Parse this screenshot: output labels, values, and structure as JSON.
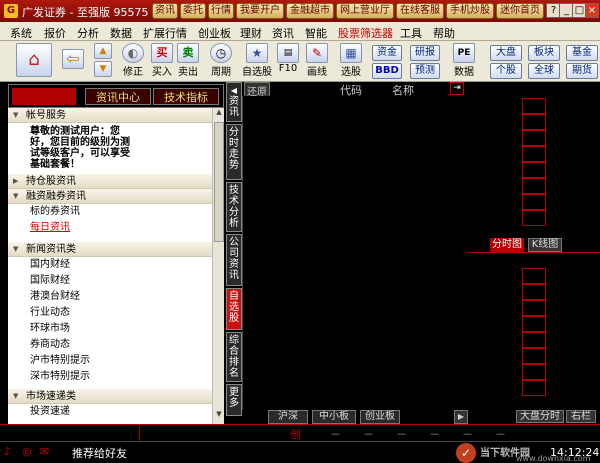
{
  "window": {
    "title": "广发证券 - 至强版",
    "title_overlay": "至强版",
    "phone": "95575",
    "top_buttons": [
      "资讯",
      "委托",
      "行情",
      "我要开户",
      "金融超市",
      "网上营业厅",
      "在线客服",
      "手机炒股",
      "迷你首页"
    ],
    "window_controls": [
      "?",
      "_",
      "□",
      "×"
    ]
  },
  "menu": [
    "系统",
    "报价",
    "分析",
    "数据",
    "扩展行情",
    "创业板",
    "理财",
    "资讯",
    "智能",
    "股票筛选器",
    "工具",
    "帮助"
  ],
  "toolbar": {
    "labels": [
      "修正",
      "买入",
      "卖出",
      "周期",
      "自选股",
      "F10",
      "画线",
      "选股",
      "数据"
    ],
    "buy_glyph": "买",
    "sell_glyph": "卖",
    "small_buttons": [
      "资金",
      "BBD",
      "研报",
      "预测",
      "大盘",
      "个股",
      "板块",
      "全球",
      "基金",
      "期货"
    ],
    "pe_label": "PE"
  },
  "left_panel": {
    "tabs": [
      "资讯中心",
      "技术指标"
    ],
    "sections": [
      {
        "title": "帐号服务",
        "collapsed": false
      },
      {
        "title": "持仓股资讯",
        "collapsed": true
      },
      {
        "title": "融资融券资讯",
        "collapsed": false
      },
      {
        "title": "新闻资讯类",
        "collapsed": false
      },
      {
        "title": "市场速递类",
        "collapsed": false
      }
    ],
    "message_line1": "尊敬的测试用户：您",
    "message_line2": "好，您目前的级别为测",
    "message_line3": "试等级客户，可以享受",
    "message_line4": "基础套餐！",
    "margin_items": [
      "标的券资讯",
      "每日资讯"
    ],
    "news_items": [
      "国内财经",
      "国际财经",
      "港澳台财经",
      "行业动态",
      "环球市场",
      "券商动态",
      "沪市特别提示",
      "深市特别提示"
    ],
    "market_items": [
      "投资速递"
    ]
  },
  "vertical_tabs": [
    "分时走势",
    "技术分析",
    "公司资讯",
    "自选股",
    "综合排名",
    "更多"
  ],
  "vtab_label_top": "资讯",
  "grid": {
    "back_label": "还原",
    "code_header": "代码",
    "name_header": "名称"
  },
  "bottom_tabs": [
    "沪深",
    "中小板",
    "创业板"
  ],
  "right_panel": {
    "tabs": [
      "分时图",
      "K线图"
    ],
    "bottom_tabs": [
      "大盘分时",
      "右栏"
    ]
  },
  "status": {
    "center_label": "创",
    "dashes": "－　　－　　－　　－　　－　　－"
  },
  "taskbar": {
    "recommend": "推荐给好友",
    "time": "14:12:24",
    "watermark": "当下软件园",
    "watermark_url": "www.downxia.com"
  }
}
